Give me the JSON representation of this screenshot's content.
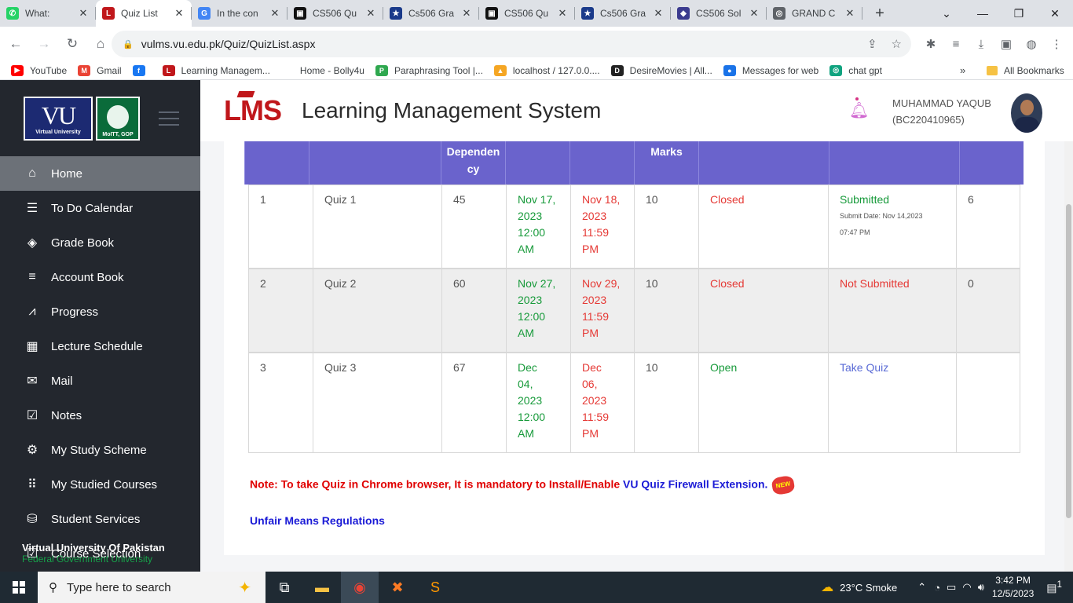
{
  "browser": {
    "tabs": [
      {
        "title": "What: ",
        "icon": "whatsapp-icon",
        "color": "#25d366",
        "glyph": "✆"
      },
      {
        "title": "Quiz List",
        "icon": "lms-icon",
        "color": "#c0171b",
        "glyph": "L",
        "active": true
      },
      {
        "title": "In the con",
        "icon": "google-icon",
        "color": "#4285f4",
        "glyph": "G"
      },
      {
        "title": "CS506 Qu",
        "icon": "quiz-icon",
        "color": "#111111",
        "glyph": "▣"
      },
      {
        "title": "Cs506 Gra",
        "icon": "star-icon",
        "color": "#1a3a8a",
        "glyph": "★"
      },
      {
        "title": "CS506 Qu",
        "icon": "quiz-icon",
        "color": "#111111",
        "glyph": "▣"
      },
      {
        "title": "Cs506 Gra",
        "icon": "star-icon",
        "color": "#1a3a8a",
        "glyph": "★"
      },
      {
        "title": "CS506 Sol",
        "icon": "site-icon",
        "color": "#3b3b8f",
        "glyph": "◆"
      },
      {
        "title": "GRAND C",
        "icon": "globe-icon",
        "color": "#5f6368",
        "glyph": "◎"
      }
    ],
    "url": "vulms.vu.edu.pk/Quiz/QuizList.aspx",
    "bookmarks": [
      {
        "label": "YouTube",
        "color": "#ff0000",
        "glyph": "▶"
      },
      {
        "label": "Gmail",
        "color": "#ea4335",
        "glyph": "M"
      },
      {
        "label": "",
        "color": "#1877f2",
        "glyph": "f"
      },
      {
        "label": "Learning Managem...",
        "color": "#c0171b",
        "glyph": "L"
      },
      {
        "label": "Home - Bolly4u",
        "color": "#ffffff",
        "glyph": ""
      },
      {
        "label": "Paraphrasing Tool |...",
        "color": "#2fa84f",
        "glyph": "P"
      },
      {
        "label": "localhost / 127.0.0....",
        "color": "#f5a623",
        "glyph": "▲"
      },
      {
        "label": "DesireMovies | All...",
        "color": "#222222",
        "glyph": "D"
      },
      {
        "label": "Messages for web",
        "color": "#1a73e8",
        "glyph": "●"
      },
      {
        "label": "chat gpt",
        "color": "#10a37f",
        "glyph": "◎"
      }
    ],
    "more": "»",
    "all_bookmarks": "All Bookmarks"
  },
  "sidebar": {
    "logo_vu_text": "VU",
    "logo_vu_sub": "Virtual University",
    "logo_gov_sub": "MoITT, GOP",
    "items": [
      {
        "label": "Home",
        "icon": "home-icon",
        "glyph": "⌂",
        "active": true
      },
      {
        "label": "To Do Calendar",
        "icon": "list-icon",
        "glyph": "☰"
      },
      {
        "label": "Grade Book",
        "icon": "layers-icon",
        "glyph": "◈"
      },
      {
        "label": "Account Book",
        "icon": "sliders-icon",
        "glyph": "≡"
      },
      {
        "label": "Progress",
        "icon": "chart-icon",
        "glyph": "⩘"
      },
      {
        "label": "Lecture Schedule",
        "icon": "calendar-icon",
        "glyph": "▦"
      },
      {
        "label": "Mail",
        "icon": "mail-icon",
        "glyph": "✉"
      },
      {
        "label": "Notes",
        "icon": "checklist-icon",
        "glyph": "☑"
      },
      {
        "label": "My Study Scheme",
        "icon": "gear-icon",
        "glyph": "⚙"
      },
      {
        "label": "My Studied Courses",
        "icon": "grid-icon",
        "glyph": "⠿"
      },
      {
        "label": "Student Services",
        "icon": "bag-icon",
        "glyph": "⛁"
      },
      {
        "label": "Course Selection",
        "icon": "checkbox-icon",
        "glyph": "☑"
      }
    ],
    "footer_line1": "Virtual University Of Pakistan",
    "footer_line2": "Federal Government University"
  },
  "header": {
    "logo": "LMS",
    "title": "Learning Management System",
    "user_name": "MUHAMMAD YAQUB",
    "user_id": "(BC220410965)"
  },
  "table": {
    "headers": [
      "",
      "",
      "Dependen cy",
      "",
      "",
      "Marks",
      "",
      "",
      ""
    ],
    "rows": [
      {
        "no": "1",
        "title": "Quiz 1",
        "dependency": "45",
        "start": [
          "Nov 17,",
          "2023",
          "12:00",
          "AM"
        ],
        "end": [
          "Nov 18,",
          "2023",
          "11:59",
          "PM"
        ],
        "marks": "10",
        "status": "Closed",
        "result": "Submitted",
        "submit_date": [
          "Submit Date: Nov 14,2023",
          "07:47 PM"
        ],
        "obtained": "6"
      },
      {
        "no": "2",
        "title": "Quiz 2",
        "dependency": "60",
        "start": [
          "Nov 27,",
          "2023",
          "12:00",
          "AM"
        ],
        "end": [
          "Nov 29,",
          "2023",
          "11:59",
          "PM"
        ],
        "marks": "10",
        "status": "Closed",
        "result": "Not Submitted",
        "submit_date": [],
        "obtained": "0"
      },
      {
        "no": "3",
        "title": "Quiz 3",
        "dependency": "67",
        "start": [
          "Dec",
          "04,",
          "2023",
          "12:00",
          "AM"
        ],
        "end": [
          "Dec",
          "06,",
          "2023",
          "11:59",
          "PM"
        ],
        "marks": "10",
        "status": "Open",
        "result": "Take Quiz",
        "submit_date": [],
        "obtained": ""
      }
    ]
  },
  "note": {
    "prefix": "Note: To take Quiz in Chrome browser, It is mandatory to Install/Enable ",
    "link": "VU Quiz Firewall Extension.",
    "badge": "NEW"
  },
  "unfair_link": "Unfair Means Regulations",
  "taskbar": {
    "search_placeholder": "Type here to search",
    "weather": "23°C  Smoke",
    "time": "3:42 PM",
    "date": "12/5/2023",
    "notifications": "1"
  }
}
